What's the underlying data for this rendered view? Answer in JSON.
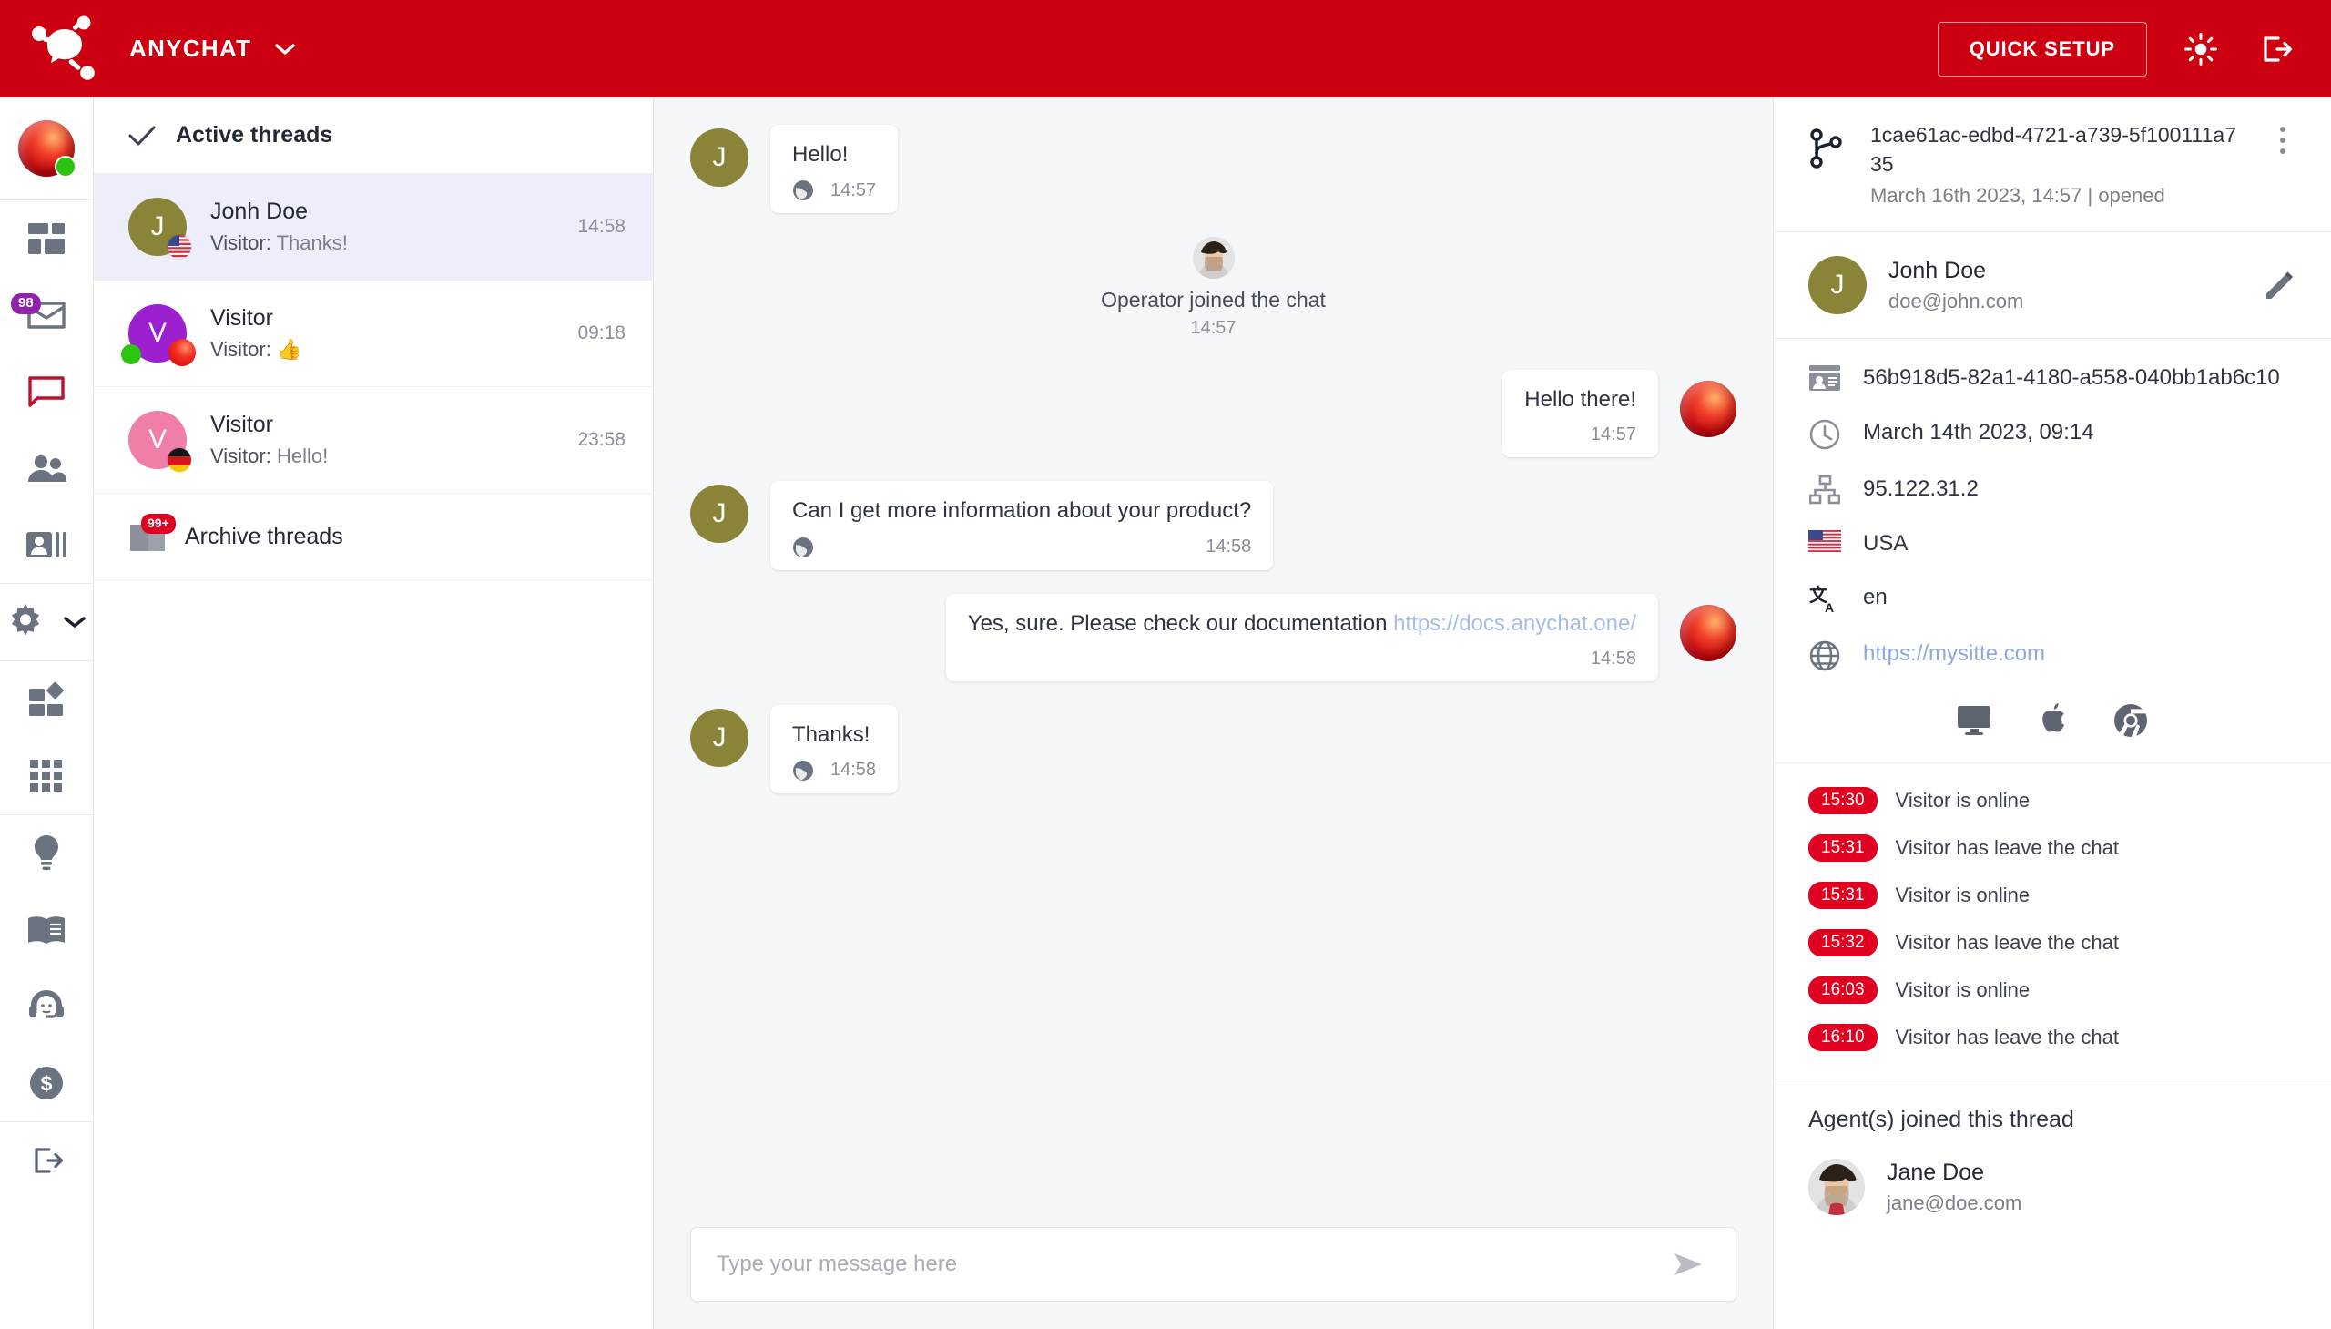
{
  "topbar": {
    "brand_name": "ANYCHAT",
    "logo_icon": "anychat-logo-icon",
    "caret_icon": "chevron-down-icon",
    "quick_setup_label": "QUICK SETUP",
    "brightness_icon": "sun-icon",
    "logout_icon": "logout-icon",
    "background_color": "#cc0011"
  },
  "rail": {
    "avatar_status_color": "#2bc40f",
    "items": [
      {
        "name": "user-avatar",
        "icon": "operator-avatar-icon",
        "badge": ""
      },
      {
        "name": "dashboard",
        "icon": "dashboard-icon",
        "badge": ""
      },
      {
        "name": "inbox",
        "icon": "inbox-icon",
        "badge": "98"
      },
      {
        "name": "chats",
        "icon": "chat-bubble-icon",
        "badge": "",
        "active": true
      },
      {
        "name": "visitors",
        "icon": "people-icon",
        "badge": ""
      },
      {
        "name": "contacts",
        "icon": "contact-card-icon",
        "badge": ""
      },
      {
        "name": "settings",
        "icon": "gear-icon",
        "badge": ""
      },
      {
        "name": "integrations",
        "icon": "puzzle-blocks-icon",
        "badge": ""
      },
      {
        "name": "apps",
        "icon": "apps-grid-icon",
        "badge": ""
      },
      {
        "name": "tips",
        "icon": "lightbulb-icon",
        "badge": ""
      },
      {
        "name": "knowledge-base",
        "icon": "book-icon",
        "badge": ""
      },
      {
        "name": "support",
        "icon": "headset-icon",
        "badge": ""
      },
      {
        "name": "billing",
        "icon": "dollar-coin-icon",
        "badge": ""
      },
      {
        "name": "sign-out",
        "icon": "logout-icon",
        "badge": ""
      }
    ],
    "badge_purple_color": "#8e24aa"
  },
  "threads": {
    "active_header": "Active threads",
    "active_header_icon": "check-icon",
    "archive_label": "Archive threads",
    "archive_icon": "archive-folder-icon",
    "archive_badge": "99+",
    "items": [
      {
        "name": "Jonh Doe",
        "initial": "J",
        "avatar_color": "#8a8438",
        "preview_prefix": "Visitor:",
        "preview_text": "Thanks!",
        "time": "14:58",
        "flag": "us",
        "selected": true,
        "online_dot": false,
        "operator_dot": false
      },
      {
        "name": "Visitor",
        "initial": "V",
        "avatar_color": "#9c1fd0",
        "preview_prefix": "Visitor:",
        "preview_text": "👍",
        "time": "09:18",
        "flag": "",
        "selected": false,
        "online_dot": true,
        "operator_dot": true
      },
      {
        "name": "Visitor",
        "initial": "V",
        "avatar_color": "#ef7fa8",
        "preview_prefix": "Visitor:",
        "preview_text": "Hello!",
        "time": "23:58",
        "flag": "de",
        "selected": false,
        "online_dot": false,
        "operator_dot": false
      }
    ]
  },
  "chat": {
    "background_color": "#f5f6f8",
    "messages": [
      {
        "kind": "in",
        "text": "Hello!",
        "time": "14:57",
        "avatar_initial": "J",
        "avatar_color": "#8a8438",
        "source_icon": "globe-icon"
      },
      {
        "kind": "system",
        "text": "Operator joined the chat",
        "time": "14:57",
        "avatar": "jane-doe-photo"
      },
      {
        "kind": "out",
        "text": "Hello there!",
        "time": "14:57",
        "avatar": "operator-sphere-avatar"
      },
      {
        "kind": "in",
        "text": "Can I get more information about your product?",
        "time": "14:58",
        "avatar_initial": "J",
        "avatar_color": "#8a8438",
        "source_icon": "globe-icon"
      },
      {
        "kind": "out",
        "text": "Yes, sure. Please check our documentation ",
        "link_text": "https://docs.anychat.one/",
        "time": "14:58",
        "avatar": "operator-sphere-avatar"
      },
      {
        "kind": "in",
        "text": "Thanks!",
        "time": "14:58",
        "avatar_initial": "J",
        "avatar_color": "#8a8438",
        "source_icon": "globe-icon"
      }
    ],
    "composer": {
      "placeholder": "Type your message here",
      "value": "",
      "send_icon": "send-arrow-icon"
    },
    "link_color": "#a7bde8"
  },
  "info": {
    "thread": {
      "icon": "git-branch-icon",
      "id": "1cae61ac-edbd-4721-a739-5f100111a735",
      "meta": "March 16th 2023, 14:57 | opened",
      "menu_icon": "kebab-menu-icon"
    },
    "person": {
      "name": "Jonh Doe",
      "email": "doe@john.com",
      "initial": "J",
      "avatar_color": "#8a8438",
      "edit_icon": "pencil-icon"
    },
    "details": [
      {
        "icon": "contact-card-icon",
        "value": "56b918d5-82a1-4180-a558-040bb1ab6c10",
        "is_link": false
      },
      {
        "icon": "clock-icon",
        "value": "March 14th 2023, 09:14",
        "is_link": false
      },
      {
        "icon": "network-icon",
        "value": "95.122.31.2",
        "is_link": false
      },
      {
        "icon": "flag-us-icon",
        "value": "USA",
        "is_link": false
      },
      {
        "icon": "translate-icon",
        "value": "en",
        "is_link": false
      },
      {
        "icon": "globe-icon",
        "value": "https://mysitte.com",
        "is_link": true
      }
    ],
    "devices": [
      {
        "icon": "desktop-monitor-icon",
        "label": "desktop"
      },
      {
        "icon": "apple-icon",
        "label": "macOS"
      },
      {
        "icon": "chrome-icon",
        "label": "Chrome"
      }
    ],
    "events": [
      {
        "time": "15:30",
        "text": "Visitor is online"
      },
      {
        "time": "15:31",
        "text": "Visitor has leave the chat"
      },
      {
        "time": "15:31",
        "text": "Visitor is online"
      },
      {
        "time": "15:32",
        "text": "Visitor has leave the chat"
      },
      {
        "time": "16:03",
        "text": "Visitor is online"
      },
      {
        "time": "16:10",
        "text": "Visitor has leave the chat"
      }
    ],
    "event_badge_color": "#e00020",
    "agents_title": "Agent(s) joined this thread",
    "agents": [
      {
        "name": "Jane Doe",
        "email": "jane@doe.com",
        "avatar": "jane-doe-photo"
      }
    ]
  }
}
